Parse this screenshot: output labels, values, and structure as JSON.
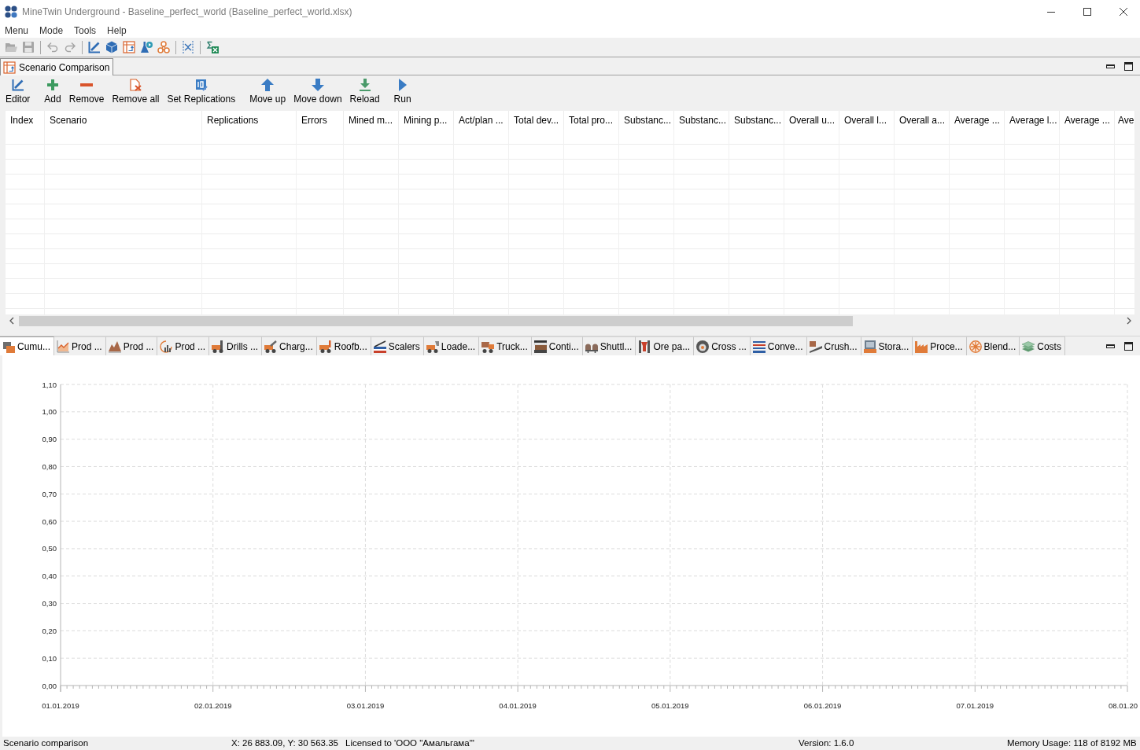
{
  "window": {
    "title": "MineTwin Underground - Baseline_perfect_world (Baseline_perfect_world.xlsx)"
  },
  "menu": [
    "Menu",
    "Mode",
    "Tools",
    "Help"
  ],
  "toolbar": {
    "groups": [
      [
        {
          "disabled": true
        },
        {
          "disabled": true
        }
      ],
      [
        {
          "disabled": true
        },
        {
          "disabled": true
        }
      ],
      [
        {
          "disabled": false
        },
        {
          "disabled": false
        },
        {
          "disabled": false
        },
        {
          "disabled": false
        },
        {
          "disabled": false
        }
      ],
      [
        {
          "disabled": false
        }
      ],
      [
        {
          "disabled": false
        }
      ]
    ]
  },
  "document_tabs": [
    {
      "label": "Scenario Comparison",
      "selected": true
    }
  ],
  "actions": [
    [
      "Editor"
    ],
    [
      "Add",
      "Remove",
      "Remove all",
      "Set Replications"
    ],
    [
      "Move up",
      "Move down",
      "Reload"
    ],
    [
      "Run"
    ]
  ],
  "table": {
    "columns": [
      "Index",
      "Scenario",
      "Replications",
      "Errors",
      "Mined m...",
      "Mining p...",
      "Act/plan ...",
      "Total dev...",
      "Total pro...",
      "Substanc...",
      "Substanc...",
      "Substanc...",
      "Overall u...",
      "Overall l...",
      "Overall a...",
      "Average ...",
      "Average l...",
      "Average ...",
      "Ave"
    ]
  },
  "chart_tabs": [
    {
      "label": "Cumu...",
      "selected": true
    },
    {
      "label": "Prod ...",
      "selected": false
    },
    {
      "label": "Prod ...",
      "selected": false
    },
    {
      "label": "Prod ...",
      "selected": false
    },
    {
      "label": "Drills ...",
      "selected": false
    },
    {
      "label": "Charg...",
      "selected": false
    },
    {
      "label": "Roofb...",
      "selected": false
    },
    {
      "label": "Scalers",
      "selected": false
    },
    {
      "label": "Loade...",
      "selected": false
    },
    {
      "label": "Truck...",
      "selected": false
    },
    {
      "label": "Conti...",
      "selected": false
    },
    {
      "label": "Shuttl...",
      "selected": false
    },
    {
      "label": "Ore pa...",
      "selected": false
    },
    {
      "label": "Cross ...",
      "selected": false
    },
    {
      "label": "Conve...",
      "selected": false
    },
    {
      "label": "Crush...",
      "selected": false
    },
    {
      "label": "Stora...",
      "selected": false
    },
    {
      "label": "Proce...",
      "selected": false
    },
    {
      "label": "Blend...",
      "selected": false
    },
    {
      "label": "Costs",
      "selected": false
    }
  ],
  "chart": {
    "chart_data": {
      "type": "line",
      "grid": true,
      "categories": [
        "01.01.2019",
        "02.01.2019",
        "03.01.2019",
        "04.01.2019",
        "05.01.2019",
        "06.01.2019",
        "07.01.2019",
        "08.01.20"
      ],
      "ylim": [
        0,
        1.1
      ],
      "yticks": [
        {
          "value": 0,
          "label": "0,00"
        },
        {
          "value": 0.1,
          "label": "0,10"
        },
        {
          "value": 0.2,
          "label": "0,20"
        },
        {
          "value": 0.3,
          "label": "0,30"
        },
        {
          "value": 0.4,
          "label": "0,40"
        },
        {
          "value": 0.5,
          "label": "0,50"
        },
        {
          "value": 0.6,
          "label": "0,60"
        },
        {
          "value": 0.7,
          "label": "0,70"
        },
        {
          "value": 0.8,
          "label": "0,80"
        },
        {
          "value": 0.9,
          "label": "0,90"
        },
        {
          "value": 1.0,
          "label": "1,00"
        },
        {
          "value": 1.1,
          "label": "1,10"
        }
      ]
    }
  },
  "status_bar": [
    "Scenario comparison",
    "X: 26 883.09, Y: 30 563.35",
    "Licensed to 'ООО \"Амальгама\"'",
    "Version: 1.6.0",
    "Memory Usage: 118 of 8192 MB"
  ]
}
